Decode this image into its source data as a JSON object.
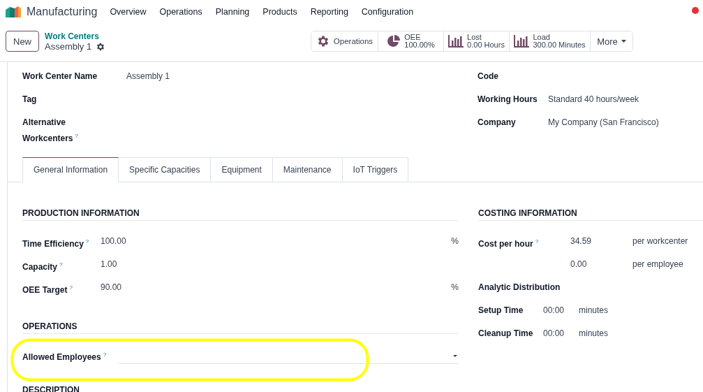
{
  "navbar": {
    "app_name": "Manufacturing",
    "menu": [
      "Overview",
      "Operations",
      "Planning",
      "Products",
      "Reporting",
      "Configuration"
    ]
  },
  "control_panel": {
    "new_button": "New",
    "breadcrumb": "Work Centers",
    "record": "Assembly 1",
    "smart_buttons": [
      {
        "kind": "gear",
        "label": "Operations"
      },
      {
        "kind": "pie",
        "label": "OEE",
        "value": "100.00%"
      },
      {
        "kind": "bars",
        "label": "Lost",
        "value": "0.00 Hours"
      },
      {
        "kind": "bars",
        "label": "Load",
        "value": "300.00 Minutes"
      },
      {
        "kind": "more",
        "label": "More"
      }
    ]
  },
  "header_fields": {
    "left": [
      {
        "label": "Work Center Name",
        "value": "Assembly 1"
      },
      {
        "label": "Tag"
      },
      {
        "label": "Alternative Workcenters",
        "help": "?"
      }
    ],
    "right": [
      {
        "label": "Code"
      },
      {
        "label": "Working Hours",
        "value": "Standard 40 hours/week"
      },
      {
        "label": "Company",
        "value": "My Company (San Francisco)"
      }
    ]
  },
  "tabs": [
    {
      "label": "General Information",
      "selected": true
    },
    {
      "label": "Specific Capacities",
      "selected": false
    },
    {
      "label": "Equipment",
      "selected": false
    },
    {
      "label": "Maintenance",
      "selected": false
    },
    {
      "label": "IoT Triggers",
      "selected": false
    }
  ],
  "production_information": {
    "title": "PRODUCTION INFORMATION",
    "fields": [
      {
        "label": "Time Efficiency",
        "help": "?",
        "value": "100.00",
        "unit": "%"
      },
      {
        "label": "Capacity",
        "help": "?",
        "value": "1.00"
      },
      {
        "label": "OEE Target",
        "help": "?",
        "value": "90.00",
        "unit": "%"
      }
    ]
  },
  "operations": {
    "title": "OPERATIONS",
    "field": {
      "label": "Allowed Employees",
      "help": "?"
    }
  },
  "description": {
    "title": "DESCRIPTION"
  },
  "costing_information": {
    "title": "COSTING INFORMATION",
    "rows": [
      {
        "kind": "cost",
        "label": "Cost per hour",
        "help": "?",
        "value": "34.59",
        "unit": "per workcenter"
      },
      {
        "kind": "cost",
        "value": "0.00",
        "unit": "per employee"
      },
      {
        "kind": "plain",
        "label": "Analytic Distribution"
      },
      {
        "kind": "time",
        "label": "Setup Time",
        "value": "00:00",
        "unit": "minutes"
      },
      {
        "kind": "time",
        "label": "Cleanup Time",
        "value": "00:00",
        "unit": "minutes"
      }
    ]
  }
}
